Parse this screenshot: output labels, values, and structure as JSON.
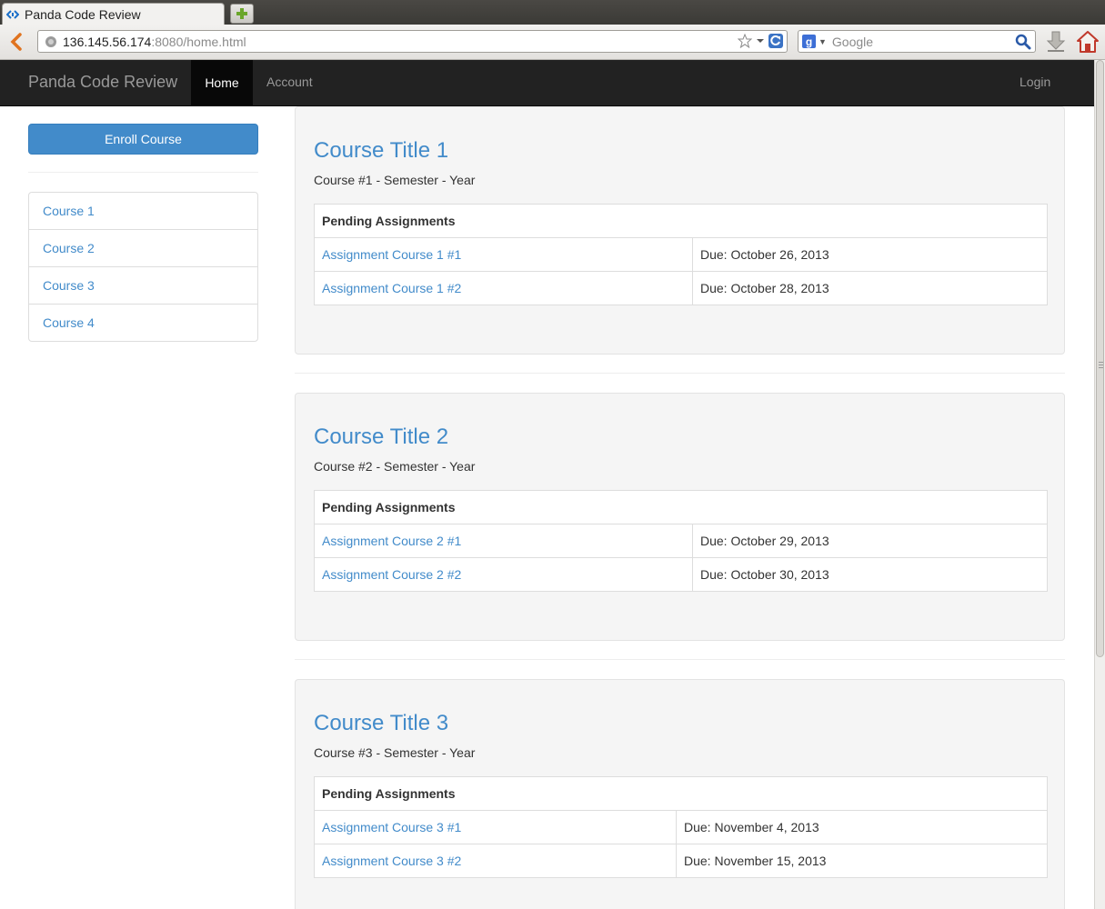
{
  "browser": {
    "tab_title": "Panda Code Review",
    "url_host": "136.145.56.174",
    "url_rest": ":8080/home.html",
    "search_placeholder": "Google"
  },
  "navbar": {
    "brand": "Panda Code Review",
    "links": [
      "Home",
      "Account"
    ],
    "active": "Home",
    "login": "Login"
  },
  "sidebar": {
    "enroll_label": "Enroll Course",
    "courses": [
      "Course 1",
      "Course 2",
      "Course 3",
      "Course 4"
    ]
  },
  "main": {
    "table_header": "Pending Assignments",
    "courses": [
      {
        "title": "Course Title 1",
        "subtitle": "Course #1 - Semester - Year",
        "assignments": [
          {
            "name": "Assignment Course 1 #1",
            "due": "Due: October 26, 2013"
          },
          {
            "name": "Assignment Course 1 #2",
            "due": "Due: October 28, 2013"
          }
        ]
      },
      {
        "title": "Course Title 2",
        "subtitle": "Course #2 - Semester - Year",
        "assignments": [
          {
            "name": "Assignment Course 2 #1",
            "due": "Due: October 29, 2013"
          },
          {
            "name": "Assignment Course 2 #2",
            "due": "Due: October 30, 2013"
          }
        ]
      },
      {
        "title": "Course Title 3",
        "subtitle": "Course #3 - Semester - Year",
        "assignments": [
          {
            "name": "Assignment Course 3 #1",
            "due": "Due: November 4, 2013"
          },
          {
            "name": "Assignment Course 3 #2",
            "due": "Due: November 15, 2013"
          }
        ]
      }
    ]
  },
  "colors": {
    "link": "#428bca",
    "navbar_bg": "#222222",
    "well_bg": "#f5f5f5"
  }
}
